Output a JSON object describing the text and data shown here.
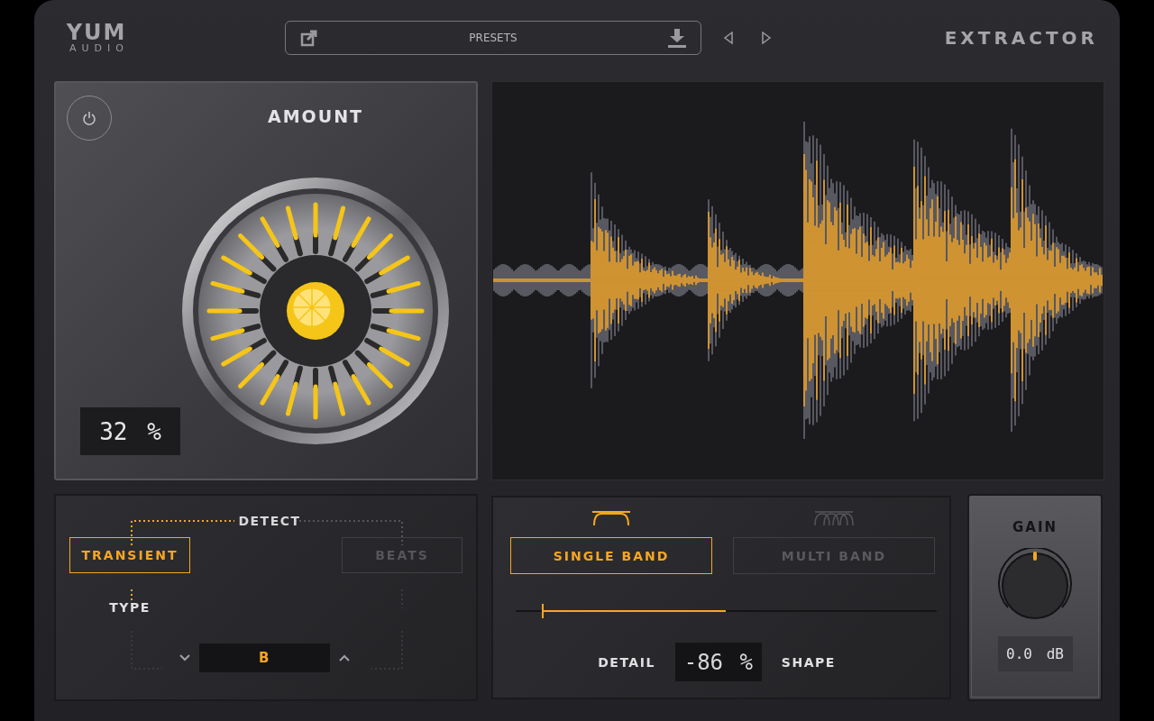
{
  "header": {
    "logo": "YUM",
    "logo_sub": "AUDIO",
    "presets_label": "PRESETS",
    "product": "EXTRACTOR"
  },
  "amount": {
    "title": "AMOUNT",
    "reading": "32 %"
  },
  "detect": {
    "title": "DETECT",
    "modes": [
      {
        "label": "TRANSIENT",
        "selected": true
      },
      {
        "label": "BEATS",
        "selected": false
      }
    ],
    "type_label": "TYPE",
    "type_value": "B"
  },
  "band": {
    "modes": [
      {
        "kind": "single",
        "label": "SINGLE BAND",
        "selected": true
      },
      {
        "kind": "multi",
        "label": "MULTI BAND",
        "selected": false
      }
    ],
    "slider": {
      "level": 0.065
    },
    "left_label": "DETAIL",
    "reading": "-86 %",
    "right_label": "SHAPE"
  },
  "gain": {
    "title": "GAIN",
    "level": 0.5,
    "reading": "0.0 dB"
  }
}
